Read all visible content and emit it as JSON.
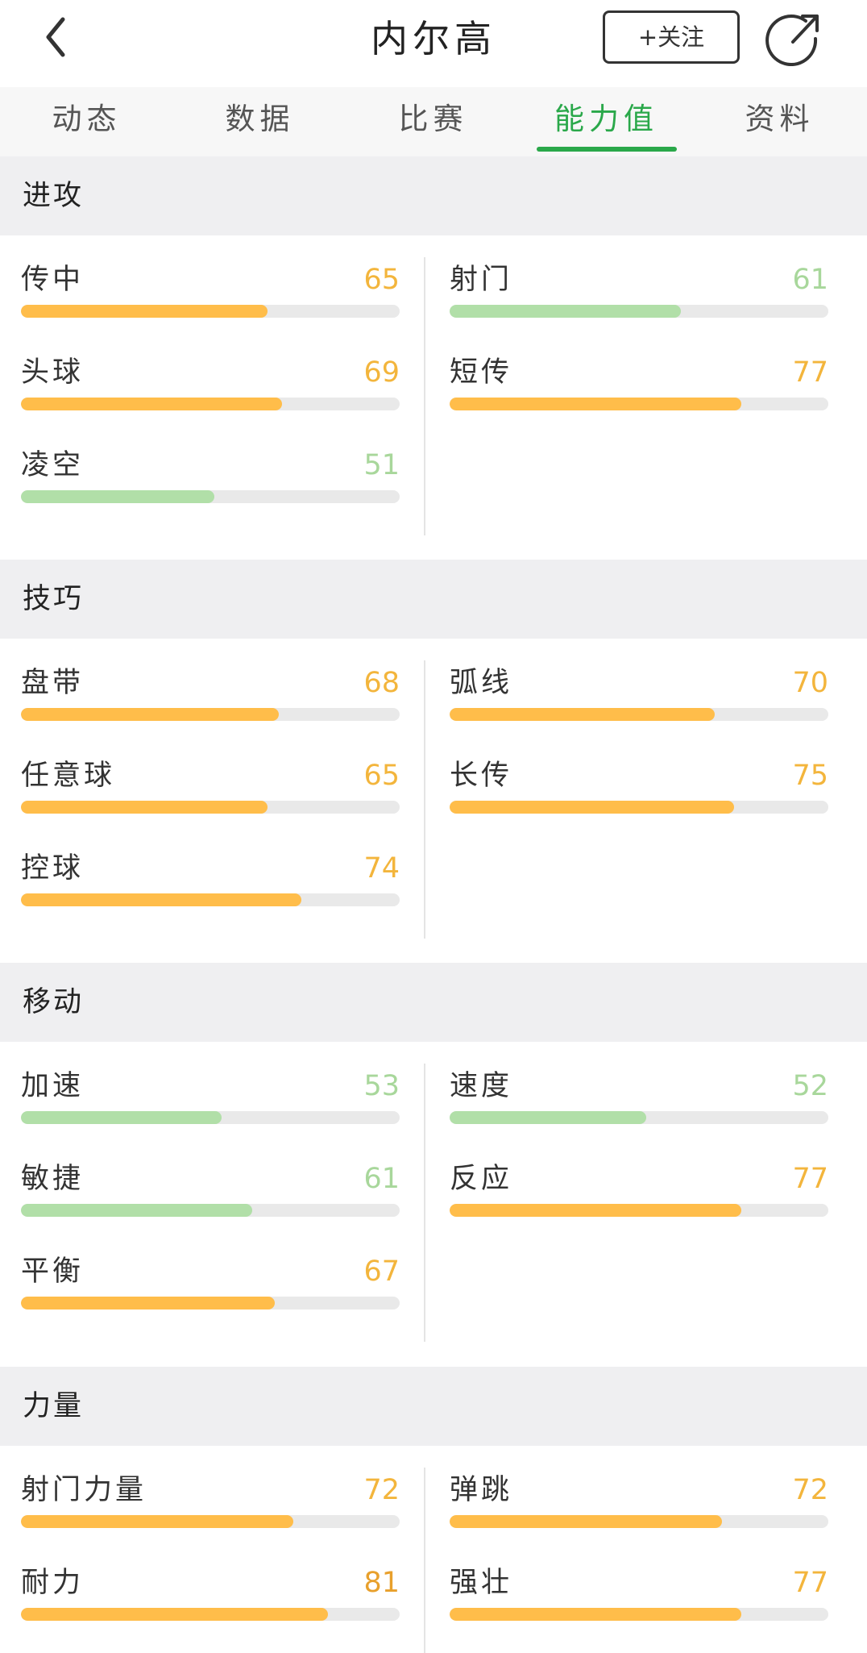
{
  "header": {
    "title": "内尔高",
    "follow_label": "+关注"
  },
  "tabs": [
    {
      "label": "动态",
      "active": false
    },
    {
      "label": "数据",
      "active": false
    },
    {
      "label": "比赛",
      "active": false
    },
    {
      "label": "能力值",
      "active": true
    },
    {
      "label": "资料",
      "active": false
    }
  ],
  "colors": {
    "accent": "#2aa84a",
    "high": "#ffbd4a",
    "high_text": "#f3b53c",
    "low": "#b1dfa8",
    "low_text": "#a8d79b",
    "track": "#e9e9e9",
    "strong_text": "#e8a02c"
  },
  "sections": [
    {
      "title": "进攻",
      "stats": [
        {
          "label": "传中",
          "value": 65
        },
        {
          "label": "射门",
          "value": 61
        },
        {
          "label": "头球",
          "value": 69
        },
        {
          "label": "短传",
          "value": 77
        },
        {
          "label": "凌空",
          "value": 51
        }
      ]
    },
    {
      "title": "技巧",
      "stats": [
        {
          "label": "盘带",
          "value": 68
        },
        {
          "label": "弧线",
          "value": 70
        },
        {
          "label": "任意球",
          "value": 65
        },
        {
          "label": "长传",
          "value": 75
        },
        {
          "label": "控球",
          "value": 74
        }
      ]
    },
    {
      "title": "移动",
      "stats": [
        {
          "label": "加速",
          "value": 53
        },
        {
          "label": "速度",
          "value": 52
        },
        {
          "label": "敏捷",
          "value": 61
        },
        {
          "label": "反应",
          "value": 77
        },
        {
          "label": "平衡",
          "value": 67
        }
      ]
    },
    {
      "title": "力量",
      "stats": [
        {
          "label": "射门力量",
          "value": 72
        },
        {
          "label": "弹跳",
          "value": 72
        },
        {
          "label": "耐力",
          "value": 81
        },
        {
          "label": "强壮",
          "value": 77
        }
      ]
    }
  ]
}
